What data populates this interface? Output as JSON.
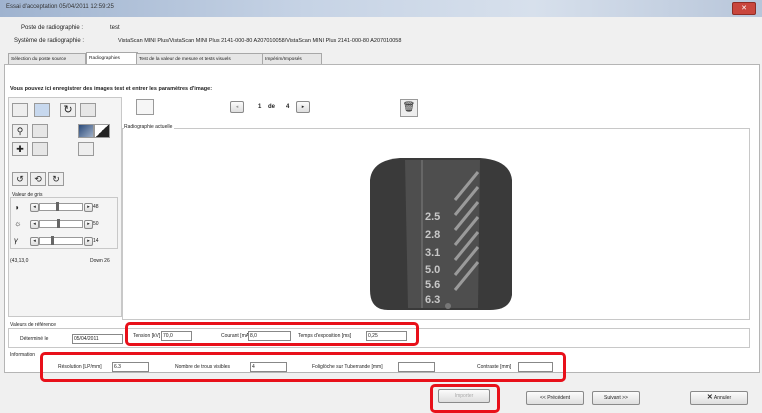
{
  "window": {
    "title": "Essai d'acceptation 05/04/2011 12:59:25",
    "close": "✕"
  },
  "header": {
    "station_label": "Poste de radiographie :",
    "station_value": "test",
    "system_label": "Système de radiographie :",
    "system_value": "VistaScan MINI Plus/VistaScan MINI Plus 2141-000-80 A207010058/VistaScan MINI Plus 2141-000-80 A207010058"
  },
  "tabs": [
    "Sélection du poste source",
    "Radiographies",
    "Test de la valeur de mesure et tests visuels",
    "Impérim/Imposés"
  ],
  "instructions": "Vous pouvez ici enregistrer des images test et entrer les paramètres d'image:",
  "pager": {
    "current": "1",
    "of": "de",
    "total": "4"
  },
  "image_area_label": "Radiographie actuelle",
  "radiograph_labels": [
    "2.5",
    "2.8",
    "3.1",
    "5.0",
    "5.6",
    "6.3"
  ],
  "gray_values": {
    "label": "Valeur de gris",
    "sliders": [
      {
        "icon": "contrast-icon",
        "value": "48",
        "level": 0.42
      },
      {
        "icon": "brightness-icon",
        "value": "50",
        "level": 0.45
      },
      {
        "icon": "gamma-icon",
        "value": "14",
        "level": 0.3
      }
    ]
  },
  "status_left": "(43,13,0",
  "status_right": "Down 26",
  "reference": {
    "group_label": "Valeurs de référence",
    "determined_label": "Déterminé le",
    "determined_value": "05/04/2011",
    "voltage_label": "Tension [kV]",
    "voltage_value": "70,0",
    "current_label": "Courant [mA]",
    "current_value": "8,0",
    "exposure_label": "Temps d'exposition [ms]",
    "exposure_value": "0,25"
  },
  "information": {
    "group_label": "Information",
    "resolution_label": "Résolution [LP/mm]",
    "resolution_value": "6.3",
    "holes_label": "Nombre de trous visibles",
    "holes_value": "4",
    "focal_label": "Foliglöche sur Tuberrande [mm]",
    "focal_value": "",
    "contrast_label": "Contraste [mm]",
    "contrast_value": ""
  },
  "buttons": {
    "import": "Importer",
    "previous": "<< Précédent",
    "next": "Suivant >>",
    "cancel": "Annuler"
  },
  "colors": {
    "highlight": "#e8101a",
    "titlebar": "#b8c6da"
  }
}
